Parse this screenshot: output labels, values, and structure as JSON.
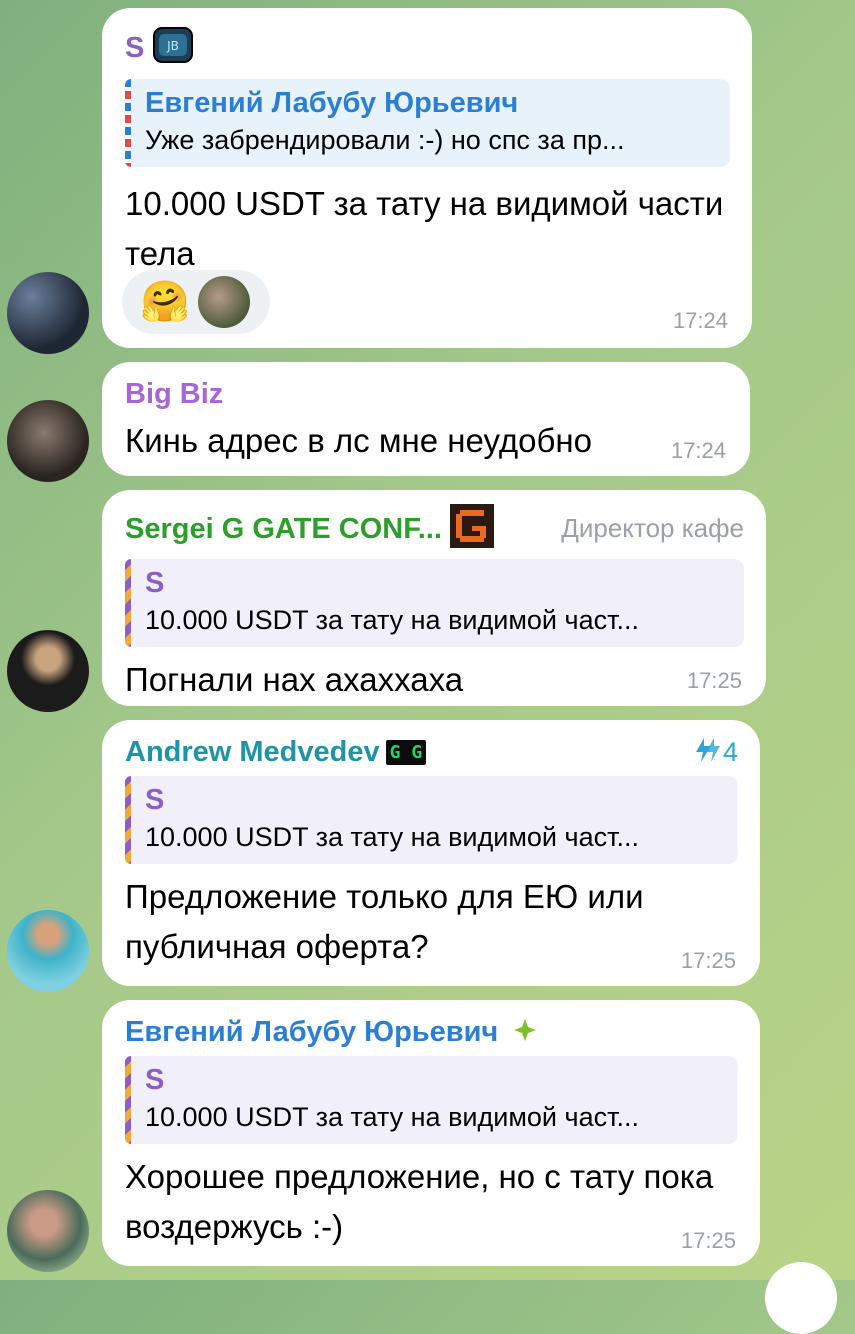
{
  "messages": [
    {
      "sender": "S",
      "sender_color": "#8a5fc7",
      "reply": {
        "name": "Евгений Лабубу Юрьевич",
        "text": "Уже забрендировали :-) но спс за пр..."
      },
      "text": "10.000 USDT за тату на видимой части тела",
      "reactions": [
        "🤗"
      ],
      "time": "17:24"
    },
    {
      "sender": "Big Biz",
      "sender_color": "#a865d6",
      "text": "Кинь адрес в лс мне неудобно",
      "time": "17:24"
    },
    {
      "sender": "Sergei G GATE CONF...",
      "sender_color": "#2e9e2b",
      "role": "Директор кафе",
      "reply": {
        "name": "S",
        "text": "10.000 USDT за тату на видимой част..."
      },
      "text": "Погнали нах ахаххаха",
      "time": "17:25"
    },
    {
      "sender": "Andrew Medvedev",
      "sender_color": "#1f93a8",
      "badge": "G G",
      "boost_count": "4",
      "reply": {
        "name": "S",
        "text": "10.000 USDT за тату на видимой част..."
      },
      "text": "Предложение только для ЕЮ или публичная оферта?",
      "time": "17:25"
    },
    {
      "sender": "Евгений Лабубу Юрьевич",
      "sender_color": "#2a7fd4",
      "reply": {
        "name": "S",
        "text": "10.000 USDT за тату на видимой част..."
      },
      "text": "Хорошее предложение, но с тату пока воздержусь :-)",
      "time": "17:25"
    }
  ]
}
